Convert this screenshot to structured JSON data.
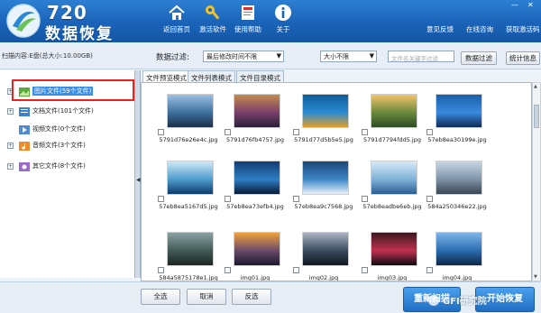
{
  "app": {
    "logo_number": "720",
    "logo_text": "数据恢复"
  },
  "toolbar": [
    {
      "label": "返回首页",
      "icon": "home-icon"
    },
    {
      "label": "激活软件",
      "icon": "key-icon"
    },
    {
      "label": "使用帮助",
      "icon": "book-icon"
    },
    {
      "label": "关于",
      "icon": "info-icon"
    }
  ],
  "header_links": {
    "feedback": "意见反馈",
    "consult": "在线咨询",
    "activation": "获取激活码"
  },
  "pathbar": {
    "scan_label": "扫描内容:E盘(总大小:10.00GB)",
    "filter_label": "数据过滤:",
    "time_filter": "最后修改时间不限",
    "size_filter": "大小不限",
    "search_placeholder": "文件名关键字过滤",
    "filter_button": "数据过滤",
    "stats_button": "统计信息"
  },
  "tree": [
    {
      "label": "图片文件(59个文件)",
      "icon": "image-folder-icon",
      "selected": true
    },
    {
      "label": "文档文件(101个文件)",
      "icon": "document-folder-icon"
    },
    {
      "label": "视频文件(0个文件)",
      "icon": "video-folder-icon"
    },
    {
      "label": "音频文件(3个文件)",
      "icon": "audio-folder-icon"
    },
    {
      "label": "其它文件(8个文件)",
      "icon": "other-folder-icon"
    }
  ],
  "tabs": [
    "文件预览模式",
    "文件列表模式",
    "文件目录模式"
  ],
  "files": [
    {
      "name": "5791d76e26e4c.jpg",
      "colors": [
        "#9cc1e3",
        "#3d6f9d",
        "#1c2f47"
      ]
    },
    {
      "name": "5791d76fb4757.jpg",
      "colors": [
        "#c58a4e",
        "#7a3f6a",
        "#2a1f3a"
      ]
    },
    {
      "name": "5791d77d5b5e5.jpg",
      "colors": [
        "#0e5d9a",
        "#2a8ad0",
        "#e3a02a"
      ]
    },
    {
      "name": "5791d7794fdd5.jpg",
      "colors": [
        "#f2c36b",
        "#6b8a3c",
        "#2c4a25"
      ]
    },
    {
      "name": "57eb8ea30199e.jpg",
      "colors": [
        "#1a5fa8",
        "#3a8ae0",
        "#0c2a55"
      ]
    },
    {
      "name": "57eb8ea5167d5.jpg",
      "colors": [
        "#cfe9f7",
        "#4f9ccd",
        "#0d3c6a"
      ]
    },
    {
      "name": "57eb8ea73efb4.jpg",
      "colors": [
        "#0f3c73",
        "#2f7fc4",
        "#091a36"
      ]
    },
    {
      "name": "57eb8ea9c7568.jpg",
      "colors": [
        "#1a4778",
        "#3d86c6",
        "#e9f2fa"
      ]
    },
    {
      "name": "57eb8eadbe6eb.jpg",
      "colors": [
        "#d7eaf7",
        "#7fb1d8",
        "#2a5e93"
      ]
    },
    {
      "name": "584a250346e22.jpg",
      "colors": [
        "#c8d7e6",
        "#7f93a8",
        "#3a4654"
      ]
    },
    {
      "name": "584a5875178e1.jpg",
      "colors": [
        "#8aa0a2",
        "#435a56",
        "#1c2624"
      ]
    },
    {
      "name": "img01.jpg",
      "colors": [
        "#f2a23c",
        "#6a4a6a",
        "#1c1a30"
      ]
    },
    {
      "name": "img02.jpg",
      "colors": [
        "#aab4c2",
        "#3a4a60",
        "#11171f"
      ]
    },
    {
      "name": "img03.jpg",
      "colors": [
        "#3a1720",
        "#c23050",
        "#0d0a10"
      ]
    },
    {
      "name": "img04.jpg",
      "colors": [
        "#7fb6e8",
        "#2a6cb0",
        "#0c2748"
      ]
    }
  ],
  "bottom": {
    "select_all": "全选",
    "cancel": "取消",
    "invert": "反选",
    "rescan": "重新扫描",
    "start_recover": "开始恢复",
    "watermark": "GFI研究院"
  }
}
